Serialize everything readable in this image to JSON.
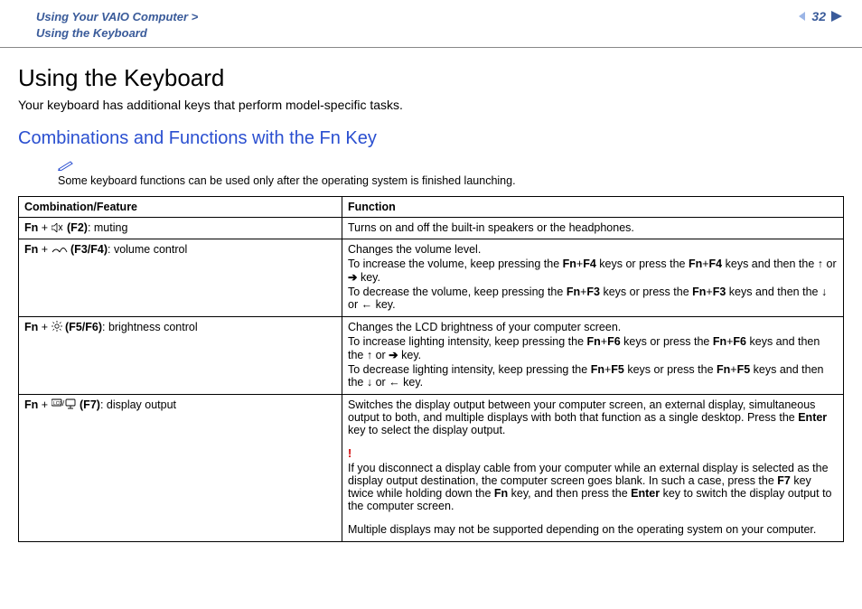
{
  "header": {
    "breadcrumb_line1": "Using Your VAIO Computer >",
    "breadcrumb_line2": "Using the Keyboard",
    "page_number": "32"
  },
  "title": "Using the Keyboard",
  "intro": "Your keyboard has additional keys that perform model-specific tasks.",
  "subhead": "Combinations and Functions with the Fn Key",
  "note": "Some keyboard functions can be used only after the operating system is finished launching.",
  "table": {
    "head_left": "Combination/Feature",
    "head_right": "Function",
    "rows": [
      {
        "left_prefix": "Fn",
        "left_plus": " + ",
        "left_key": "(F2)",
        "left_desc": ": muting",
        "icon": "mute",
        "right": {
          "p1": "Turns on and off the built-in speakers or the headphones."
        }
      },
      {
        "left_prefix": "Fn",
        "left_plus": " + ",
        "left_key": "(F3/F4)",
        "left_desc": ": volume control",
        "icon": "volume",
        "right": {
          "p1": "Changes the volume level.",
          "p2a": "To increase the volume, keep pressing the ",
          "p2b": "Fn",
          "p2c": "+",
          "p2d": "F4",
          "p2e": " keys or press the ",
          "p2f": "Fn",
          "p2g": "+",
          "p2h": "F4",
          "p2i": " keys and then the ",
          "p2j_up": "↑",
          "p2k": " or ",
          "p2l_right": "➔",
          "p2m": " key.",
          "p3a": "To decrease the volume, keep pressing the ",
          "p3b": "Fn",
          "p3c": "+",
          "p3d": "F3",
          "p3e": " keys or press the ",
          "p3f": "Fn",
          "p3g": "+",
          "p3h": "F3",
          "p3i": " keys and then the ",
          "p3j_down": "↓",
          "p3k": " or ",
          "p3l_left": "←",
          "p3m": " key."
        }
      },
      {
        "left_prefix": "Fn",
        "left_plus": " + ",
        "left_key": "(F5/F6)",
        "left_desc": ": brightness control",
        "icon": "brightness",
        "right": {
          "p1": "Changes the LCD brightness of your computer screen.",
          "p2a": "To increase lighting intensity, keep pressing the ",
          "p2b": "Fn",
          "p2c": "+",
          "p2d": "F6",
          "p2e": " keys or press the ",
          "p2f": "Fn",
          "p2g": "+",
          "p2h": "F6",
          "p2i": " keys and then the ",
          "p2j_up": "↑",
          "p2k": " or ",
          "p2l_right": "➔",
          "p2m": " key.",
          "p3a": "To decrease lighting intensity, keep pressing the ",
          "p3b": "Fn",
          "p3c": "+",
          "p3d": "F5",
          "p3e": " keys or press the ",
          "p3f": "Fn",
          "p3g": "+",
          "p3h": "F5",
          "p3i": " keys and then the ",
          "p3j_down": "↓",
          "p3k": " or ",
          "p3l_left": "←",
          "p3m": " key."
        }
      },
      {
        "left_prefix": "Fn",
        "left_plus": " + ",
        "left_key": "(F7)",
        "left_desc": ": display output",
        "icon": "display",
        "right": {
          "p1a": "Switches the display output between your computer screen, an external display, simultaneous output to both, and multiple displays with both that function as a single desktop. Press the ",
          "p1b": "Enter",
          "p1c": " key to select the display output.",
          "bang": "!",
          "p2a": "If you disconnect a display cable from your computer while an external display is selected as the display output destination, the computer screen goes blank. In such a case, press the ",
          "p2b": "F7",
          "p2c": " key twice while holding down the ",
          "p2d": "Fn",
          "p2e": " key, and then press the ",
          "p2f": "Enter",
          "p2g": " key to switch the display output to the computer screen.",
          "p3": "Multiple displays may not be supported depending on the operating system on your computer."
        }
      }
    ]
  }
}
